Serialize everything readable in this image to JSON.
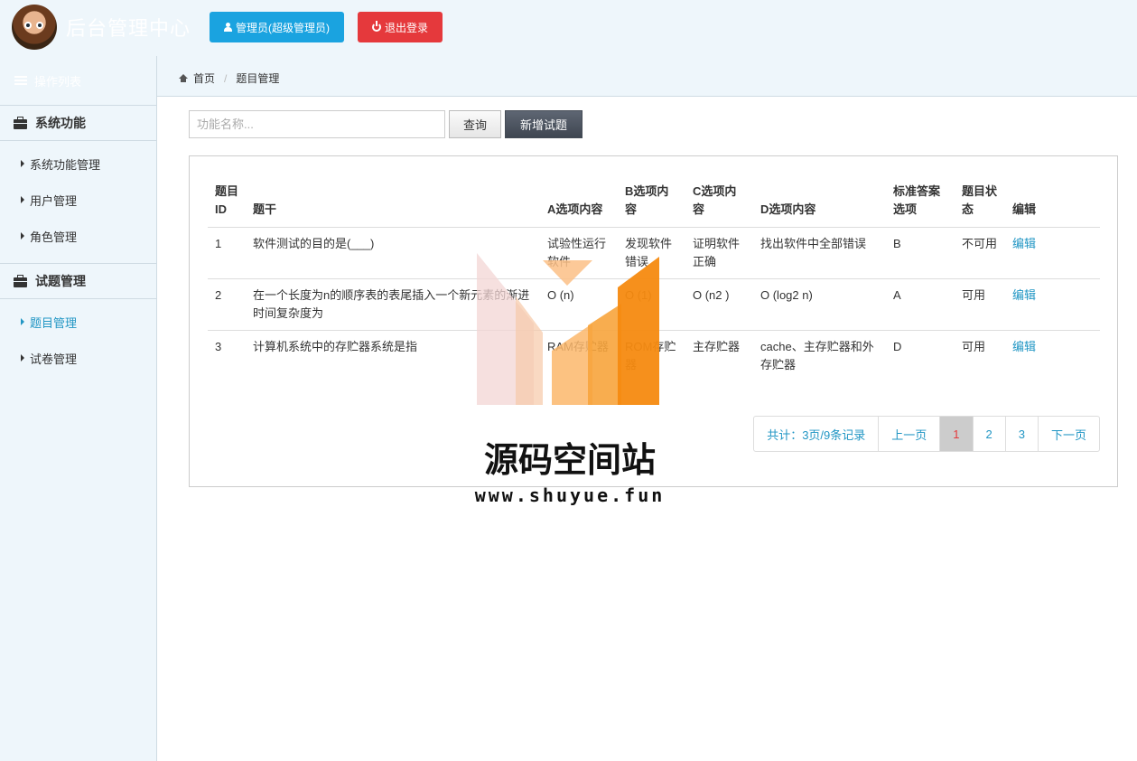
{
  "header": {
    "app_title": "后台管理中心",
    "admin_button": "管理员(超级管理员)",
    "logout_button": "退出登录"
  },
  "sidebar": {
    "header_label": "操作列表",
    "groups": [
      {
        "title": "系统功能",
        "items": [
          {
            "label": "系统功能管理"
          },
          {
            "label": "用户管理"
          },
          {
            "label": "角色管理"
          }
        ]
      },
      {
        "title": "试题管理",
        "items": [
          {
            "label": "题目管理",
            "active": true
          },
          {
            "label": "试卷管理"
          }
        ]
      }
    ]
  },
  "breadcrumb": {
    "home": "首页",
    "current": "题目管理"
  },
  "toolbar": {
    "search_placeholder": "功能名称...",
    "query_button": "查询",
    "add_button": "新增试题"
  },
  "table": {
    "headers": {
      "id": "题目ID",
      "stem": "题干",
      "a": "A选项内容",
      "b": "B选项内容",
      "c": "C选项内容",
      "d": "D选项内容",
      "answer": "标准答案选项",
      "status": "题目状态",
      "edit": "编辑"
    },
    "rows": [
      {
        "id": "1",
        "stem": "软件测试的目的是(___)",
        "a": "试验性运行软件",
        "b": "发现软件错误",
        "c": "证明软件正确",
        "d": "找出软件中全部错误",
        "answer": "B",
        "status": "不可用",
        "edit": "编辑"
      },
      {
        "id": "2",
        "stem": "在一个长度为n的顺序表的表尾插入一个新元素的渐进时间复杂度为",
        "a": "O (n)",
        "b": "O (1)",
        "c": "O (n2 )",
        "d": "O (log2 n)",
        "answer": "A",
        "status": "可用",
        "edit": "编辑"
      },
      {
        "id": "3",
        "stem": "计算机系统中的存贮器系统是指",
        "a": "RAM存贮器",
        "b": "ROM存贮器",
        "c": "主存贮器",
        "d": "cache、主存贮器和外存贮器",
        "answer": "D",
        "status": "可用",
        "edit": "编辑"
      }
    ]
  },
  "pagination": {
    "summary": "共计：3页/9条记录",
    "prev": "上一页",
    "pages": [
      "1",
      "2",
      "3"
    ],
    "current_page": "1",
    "next": "下一页"
  },
  "watermark": {
    "title": "源码空间站",
    "url": "www.shuyue.fun"
  },
  "colors": {
    "primary": "#1aa3e0",
    "danger": "#e5393c",
    "link": "#2196c4",
    "sidebar_bg": "#eef6fb"
  }
}
